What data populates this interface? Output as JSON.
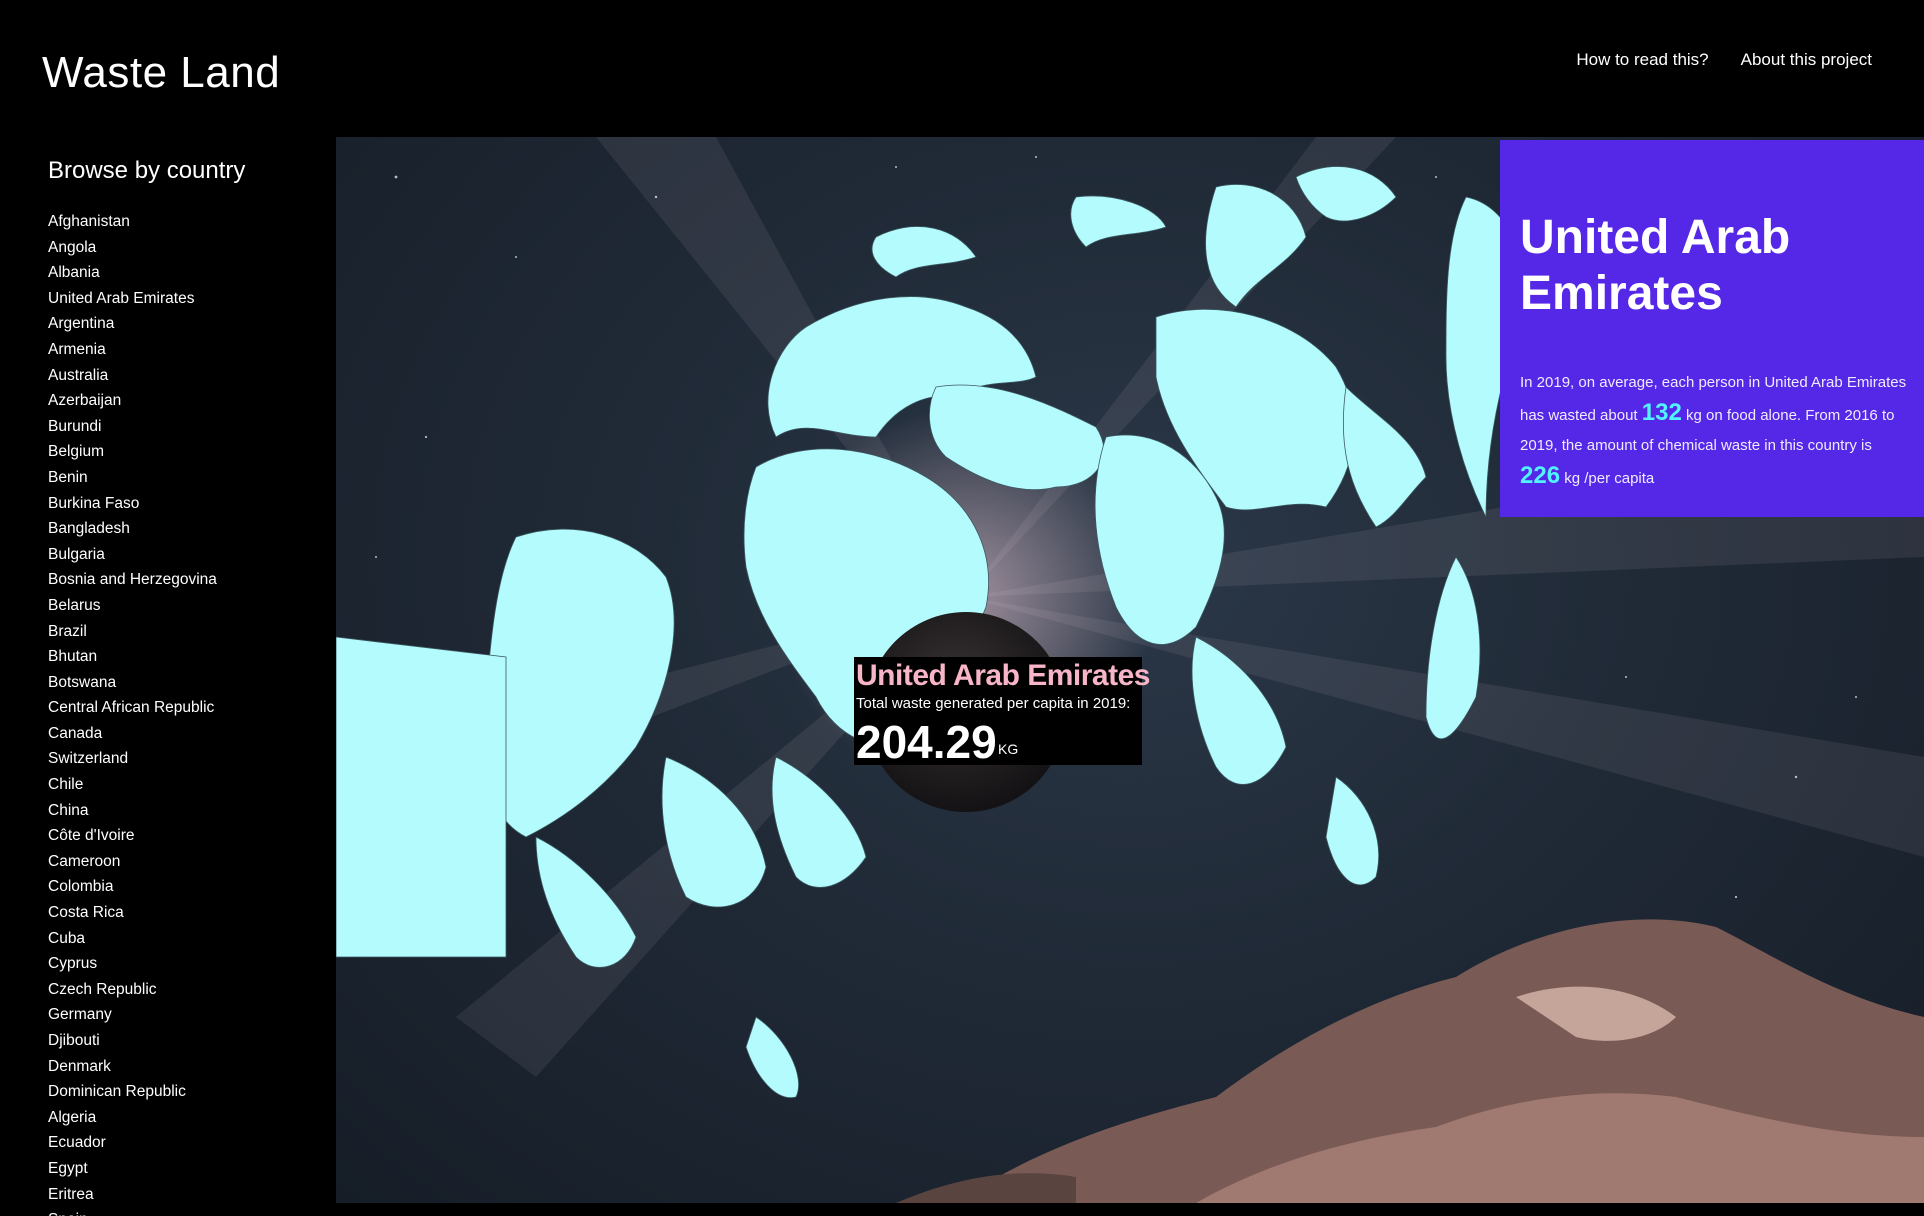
{
  "app": {
    "title": "Waste Land"
  },
  "nav": {
    "links": [
      "How to read this?",
      "About this project"
    ]
  },
  "sidebar": {
    "heading": "Browse by country",
    "countries": [
      "Afghanistan",
      "Angola",
      "Albania",
      "United Arab Emirates",
      "Argentina",
      "Armenia",
      "Australia",
      "Azerbaijan",
      "Burundi",
      "Belgium",
      "Benin",
      "Burkina Faso",
      "Bangladesh",
      "Bulgaria",
      "Bosnia and Herzegovina",
      "Belarus",
      "Brazil",
      "Bhutan",
      "Botswana",
      "Central African Republic",
      "Canada",
      "Switzerland",
      "Chile",
      "China",
      "Côte d'Ivoire",
      "Cameroon",
      "Colombia",
      "Costa Rica",
      "Cuba",
      "Cyprus",
      "Czech Republic",
      "Germany",
      "Djibouti",
      "Denmark",
      "Dominican Republic",
      "Algeria",
      "Ecuador",
      "Egypt",
      "Eritrea",
      "Spain"
    ]
  },
  "panel": {
    "country": "United Arab Emirates",
    "text_1": "In 2019, on average, each person in United Arab Emirates has wasted about",
    "food_waste": "132",
    "text_2": "kg on food alone. From 2016 to 2019, the amount of chemical waste in this country is",
    "chemical_waste": "226",
    "text_3": "kg /per capita"
  },
  "tooltip": {
    "country": "United Arab Emirates",
    "label": "Total waste generated per capita in 2019:",
    "value": "204.29",
    "unit": "KG"
  },
  "colors": {
    "land": "#b4fbfd",
    "panel": "#5527e6",
    "accent": "#52f2ff",
    "tooltip_title": "#f7b5c7"
  }
}
